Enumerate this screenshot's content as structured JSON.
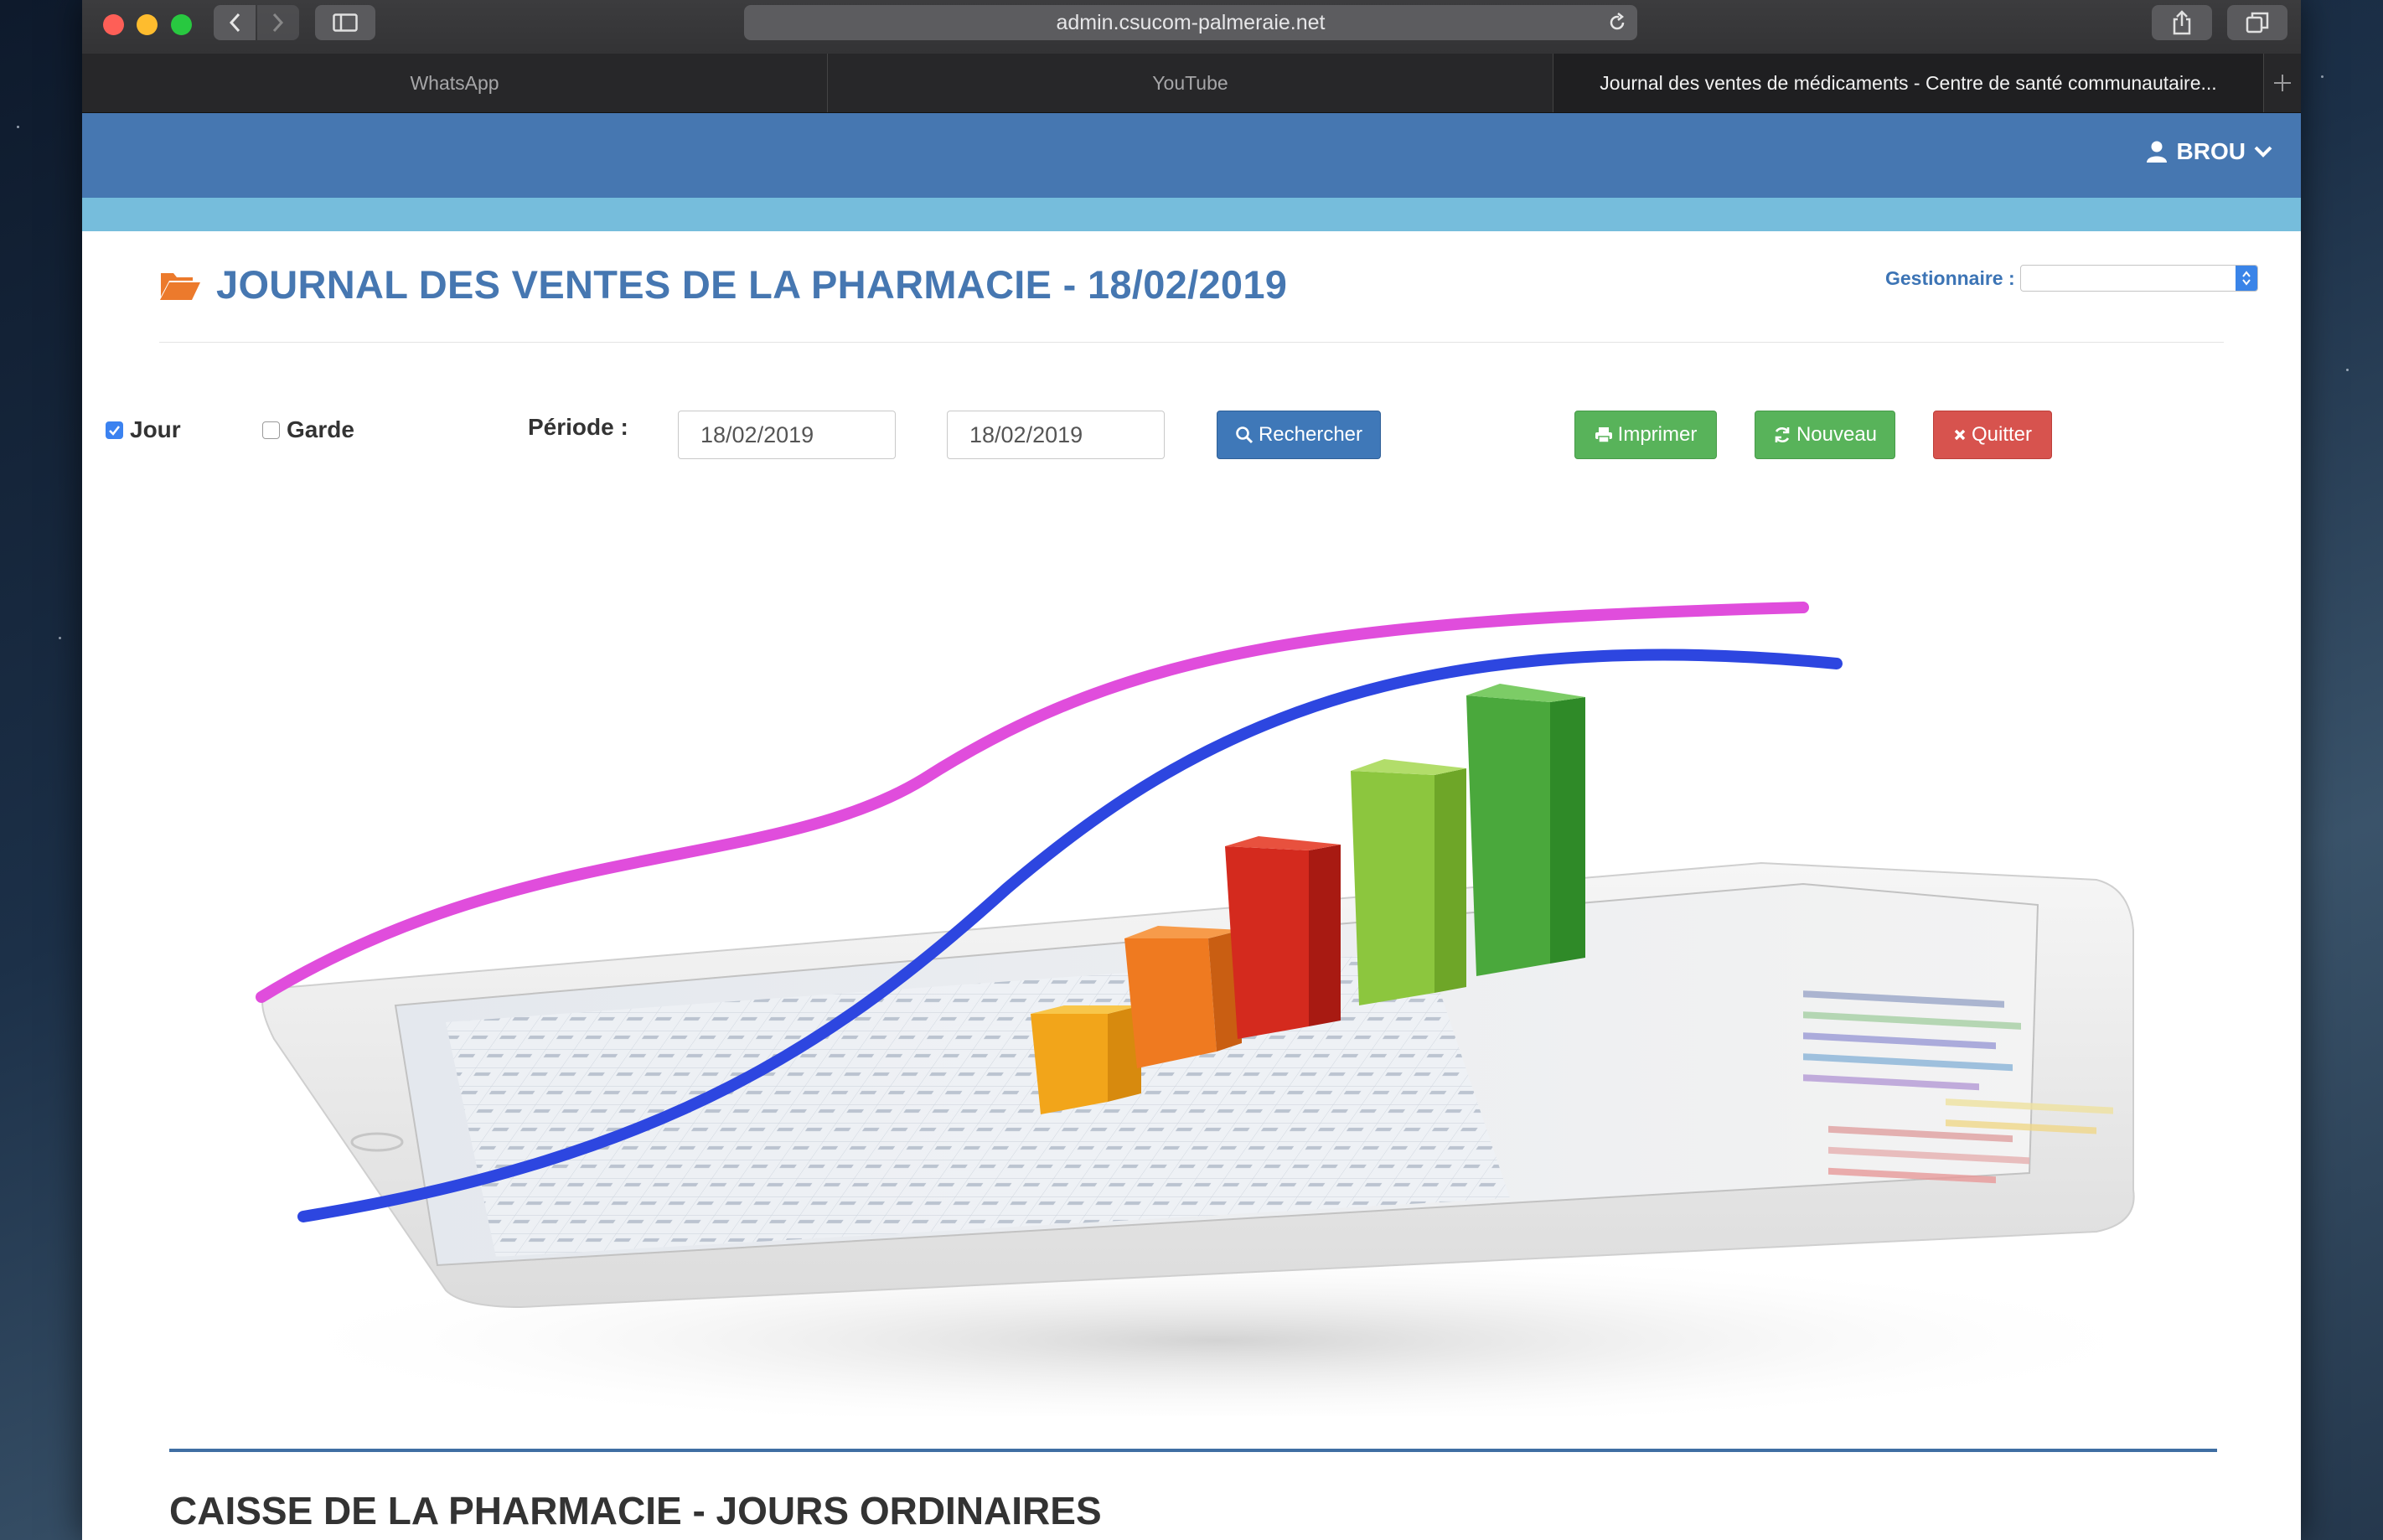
{
  "browser": {
    "url": "admin.csucom-palmeraie.net",
    "tabs": [
      {
        "label": "WhatsApp"
      },
      {
        "label": "YouTube"
      },
      {
        "label": "Journal des ventes de médicaments - Centre de santé communautaire..."
      }
    ]
  },
  "header": {
    "user_name": "BROU"
  },
  "page": {
    "title": "JOURNAL DES VENTES DE LA PHARMACIE - 18/02/2019",
    "gestionnaire_label": "Gestionnaire :",
    "gestionnaire_value": ""
  },
  "filters": {
    "jour_label": "Jour",
    "jour_checked": true,
    "garde_label": "Garde",
    "garde_checked": false,
    "periode_label": "Période :",
    "date_from": "18/02/2019",
    "date_to": "18/02/2019"
  },
  "buttons": {
    "search": "Rechercher",
    "print": "Imprimer",
    "new": "Nouveau",
    "quit": "Quitter"
  },
  "colors": {
    "brand_blue": "#4677b1",
    "sub_band": "#76bddc",
    "btn_primary": "#3f78b8",
    "btn_success": "#58b35a",
    "btn_danger": "#d7534e",
    "title_icon": "#ec7a2c"
  },
  "section": {
    "title": "CAISSE DE LA PHARMACIE - JOURS ORDINAIRES"
  }
}
